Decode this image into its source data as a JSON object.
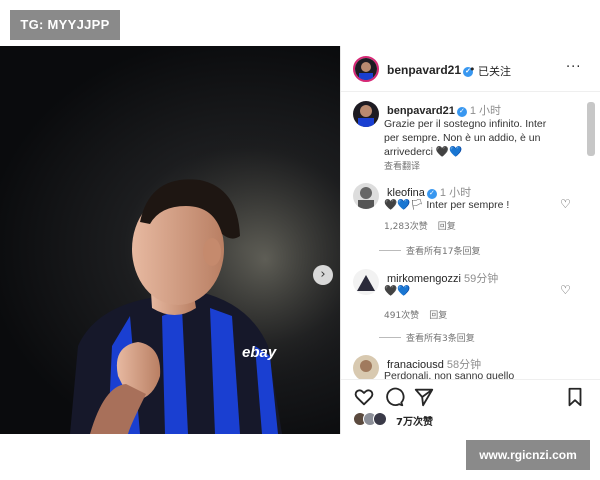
{
  "overlay": {
    "tg_label": "TG: MYYJJPP",
    "watermark": "www.rgicnzi.com"
  },
  "post": {
    "author": "benpavard21",
    "follow_sep": "•",
    "follow_label": "已关注",
    "more_label": "···",
    "image_arrow": "›",
    "sponsor_text": "ebay"
  },
  "comments": [
    {
      "user": "benpavard21",
      "time": "1 小时",
      "lines": [
        "Grazie per il sostegno infinito. Inter",
        "per sempre. Non è un addio, è un",
        "arrivederci 🖤💙"
      ],
      "translate_label": "查看翻译"
    },
    {
      "user": "kleofina",
      "time": "1 小时",
      "text": "🖤💙🏳 Inter per sempre !",
      "likes": "1,283次赞",
      "reply_label": "回复",
      "view_replies": "查看所有17条回复"
    },
    {
      "user": "mirkomengozzi",
      "time": "59分钟",
      "text": "🖤💙",
      "likes": "491次赞",
      "reply_label": "回复",
      "view_replies": "查看所有3条回复"
    },
    {
      "user": "franaciousd",
      "time": "58分钟",
      "text": "Perdonali, non sanno quello"
    }
  ],
  "likes_summary": "7万次赞",
  "colors": {
    "verified": "#3897f0",
    "story_ring": "#d62976",
    "inter_blue": "#1a3fd1",
    "heart_blue": "#3d8de3"
  }
}
